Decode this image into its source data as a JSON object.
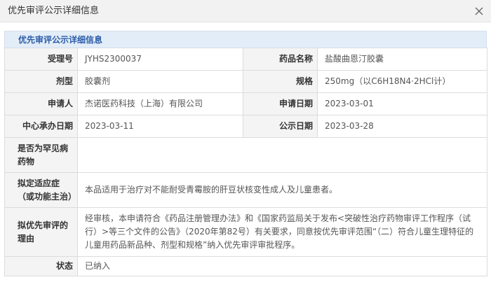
{
  "window": {
    "title": "优先审评公示详细信息"
  },
  "section": {
    "title": "优先审评公示详细信息"
  },
  "fields": {
    "acceptance_no": {
      "label": "受理号",
      "value": "JYHS2300037"
    },
    "drug_name": {
      "label": "药品名称",
      "value": "盐酸曲恩汀胶囊"
    },
    "dosage_form": {
      "label": "剂型",
      "value": "胶囊剂"
    },
    "specification": {
      "label": "规格",
      "value": "250mg（以C6H18N4·2HCl计）"
    },
    "applicant": {
      "label": "申请人",
      "value": "杰诺医药科技（上海）有限公司"
    },
    "application_date": {
      "label": "申请日期",
      "value": "2023-03-01"
    },
    "center_date": {
      "label": "中心承办日期",
      "value": "2023-03-11"
    },
    "publication_date": {
      "label": "公示日期",
      "value": "2023-03-28"
    },
    "rare_disease": {
      "label": "是否为罕见病药物",
      "value": ""
    },
    "indication": {
      "label": "拟定适应症（或功能主治）",
      "value": "本品适用于治疗对不能耐受青霉胺的肝豆状核变性成人及儿童患者。"
    },
    "reason": {
      "label": "拟优先审评的理由",
      "value": "经审核，本申请符合《药品注册管理办法》和《国家药监局关于发布<突破性治疗药物审评工作程序（试行）>等三个文件的公告》（2020年第82号）有关要求，同意按优先审评范围“（二）符合儿童生理特征的儿童用药品新品种、剂型和规格”纳入优先审评审批程序。"
    },
    "status": {
      "label": "状态",
      "value": "已纳入"
    }
  },
  "icons": {
    "close": "close-icon"
  },
  "colors": {
    "section_header_bg": "#e3edf8",
    "section_header_text": "#2b5ca8",
    "label_bg": "#f4f4f4",
    "border": "#dcdcdc"
  }
}
